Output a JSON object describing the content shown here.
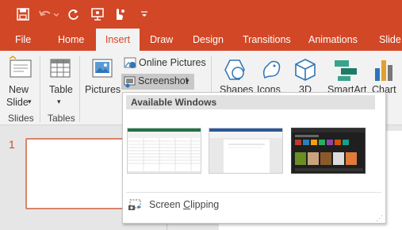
{
  "tabs": [
    "File",
    "Home",
    "Insert",
    "Draw",
    "Design",
    "Transitions",
    "Animations",
    "Slide S"
  ],
  "active_tab": "Insert",
  "ribbon": {
    "new_slide_line1": "New",
    "new_slide_line2": "Slide",
    "new_slide_caret": "▾",
    "table_label": "Table",
    "table_caret": "▾",
    "pictures_label": "Pictures",
    "online_pictures_label": "Online Pictures",
    "screenshot_label": "Screenshot",
    "screenshot_caret": "▾",
    "shapes_label": "Shapes",
    "icons_label": "Icons",
    "three_d_label": "3D",
    "smartart_label": "SmartArt",
    "chart_label": "Chart",
    "group_slides": "Slides",
    "group_tables": "Tables"
  },
  "slide_number": "1",
  "dropdown": {
    "header": "Available Windows",
    "screen_clipping_prefix": "Screen ",
    "screen_clipping_accel": "C",
    "screen_clipping_suffix": "lipping"
  },
  "colors": {
    "accent": "#d24726",
    "ribbon_bg": "#f2f2f2",
    "header_bg": "#e1e1e1"
  }
}
